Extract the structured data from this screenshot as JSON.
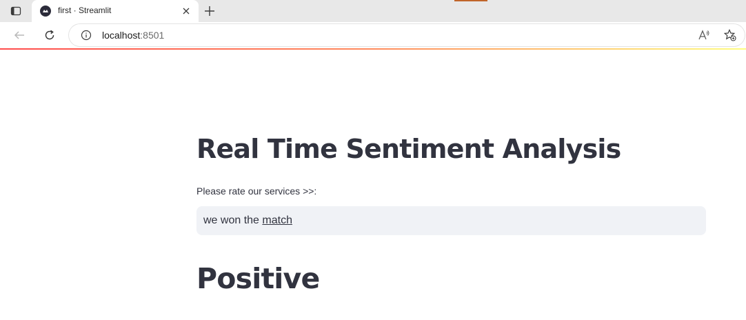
{
  "browser": {
    "tab": {
      "title": "first · Streamlit"
    },
    "address_bar": {
      "host": "localhost",
      "port": ":8501"
    },
    "read_aloud_label": "A⁾",
    "colors": {
      "accent_gradient_start": "#ff4b4b",
      "accent_gradient_end": "#fffd80",
      "tab_progress": "#c0652a"
    }
  },
  "app": {
    "title": "Real Time Sentiment Analysis",
    "input": {
      "label": "Please rate our services >>:",
      "value_prefix": "we won the ",
      "value_underlined": "match"
    },
    "result": "Positive",
    "colors": {
      "text": "#31333f",
      "input_background": "#f0f2f6"
    }
  }
}
